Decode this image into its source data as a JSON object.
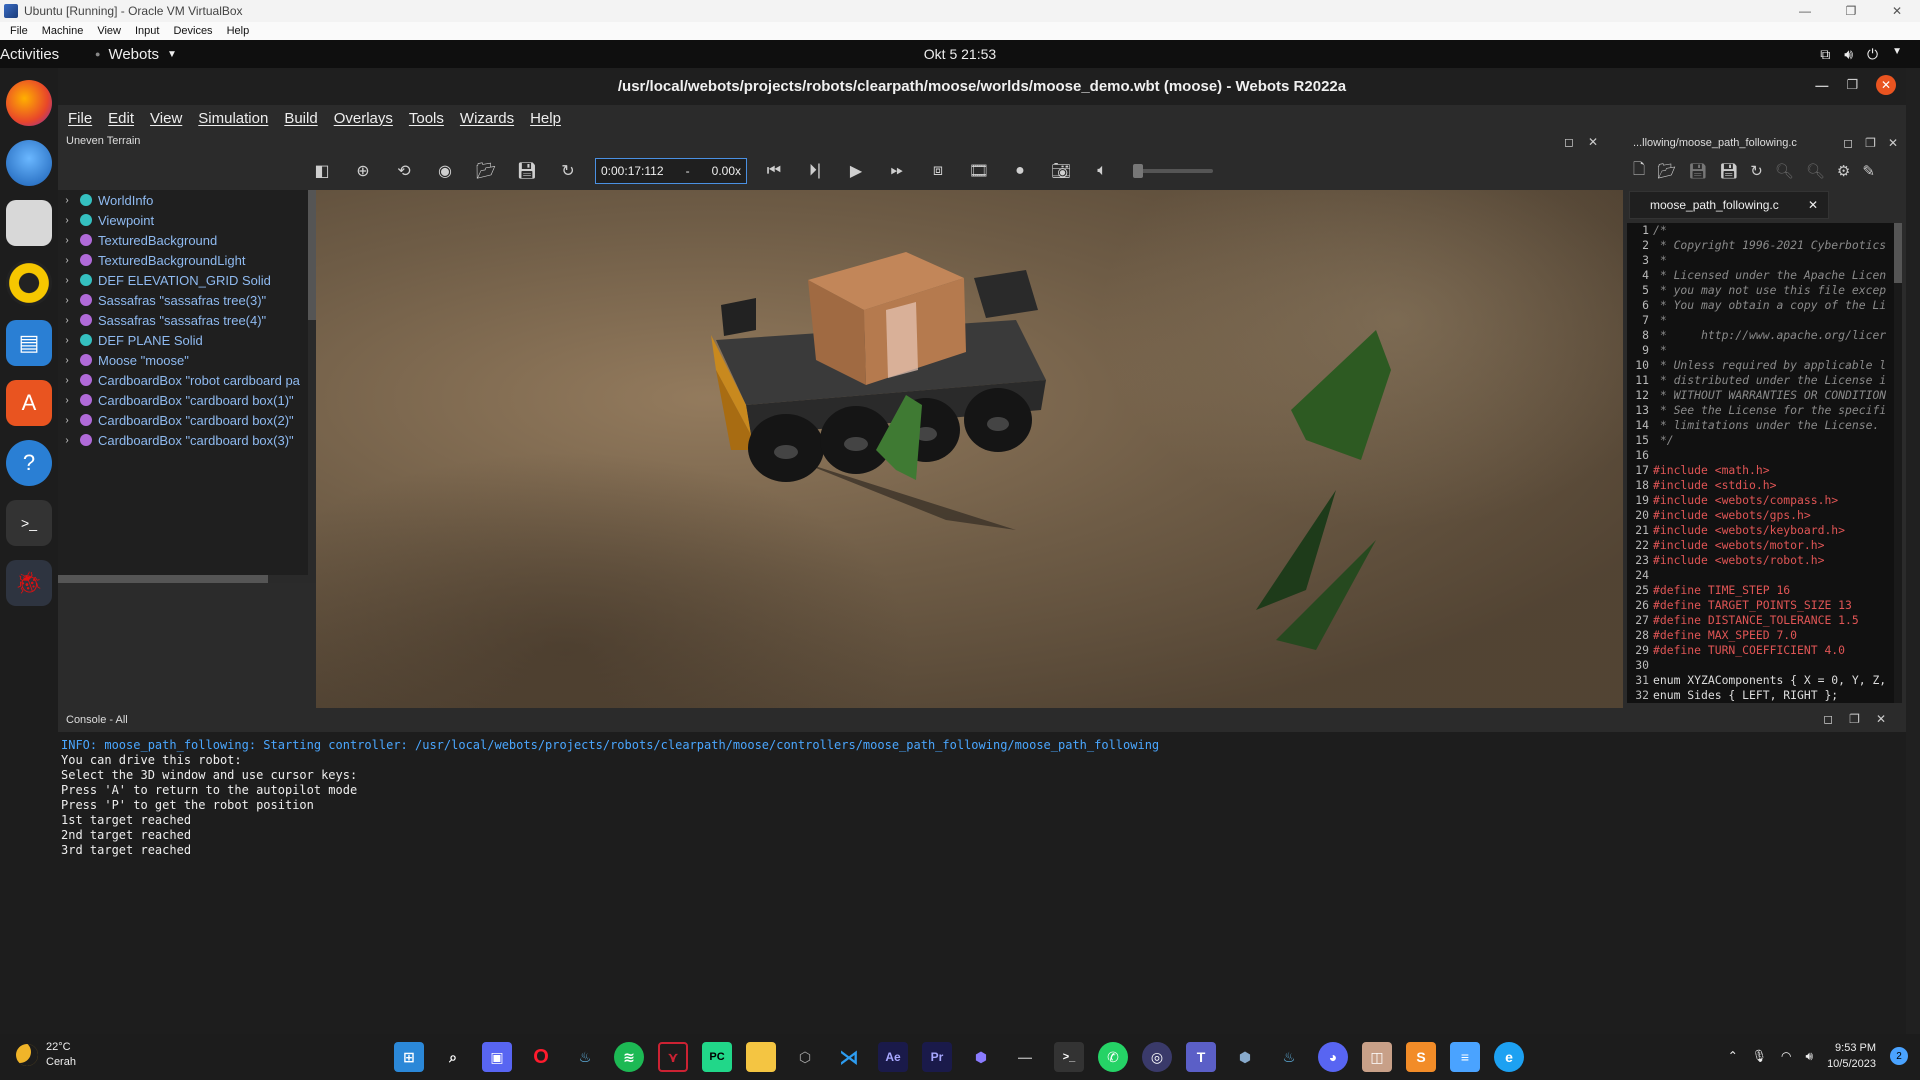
{
  "host": {
    "title": "Ubuntu [Running] - Oracle VM VirtualBox",
    "menu": [
      "File",
      "Machine",
      "View",
      "Input",
      "Devices",
      "Help"
    ]
  },
  "ubuntu": {
    "activities": "Activities",
    "app_name": "Webots",
    "clock": "Okt 5  21:53"
  },
  "webots": {
    "title": "/usr/local/webots/projects/robots/clearpath/moose/worlds/moose_demo.wbt (moose) - Webots R2022a",
    "menu": [
      "File",
      "Edit",
      "View",
      "Simulation",
      "Build",
      "Overlays",
      "Tools",
      "Wizards",
      "Help"
    ],
    "scene_label": "Uneven Terrain",
    "sim_time": "0:00:17:112",
    "sim_dash": "-",
    "sim_speed": "0.00x",
    "tree": [
      {
        "label": "WorldInfo",
        "color": "#35c0c0"
      },
      {
        "label": "Viewpoint",
        "color": "#35c0c0"
      },
      {
        "label": "TexturedBackground",
        "color": "#b06ad8"
      },
      {
        "label": "TexturedBackgroundLight",
        "color": "#b06ad8"
      },
      {
        "label": "DEF ELEVATION_GRID Solid",
        "color": "#35c0c0"
      },
      {
        "label": "Sassafras \"sassafras tree(3)\"",
        "color": "#b06ad8"
      },
      {
        "label": "Sassafras \"sassafras tree(4)\"",
        "color": "#b06ad8"
      },
      {
        "label": "DEF PLANE Solid",
        "color": "#35c0c0"
      },
      {
        "label": "Moose \"moose\"",
        "color": "#b06ad8"
      },
      {
        "label": "CardboardBox \"robot cardboard pa",
        "color": "#b06ad8"
      },
      {
        "label": "CardboardBox \"cardboard box(1)\"",
        "color": "#b06ad8"
      },
      {
        "label": "CardboardBox \"cardboard box(2)\"",
        "color": "#b06ad8"
      },
      {
        "label": "CardboardBox \"cardboard box(3)\"",
        "color": "#b06ad8"
      }
    ],
    "editor": {
      "header": "...llowing/moose_path_following.c",
      "tab": "moose_path_following.c",
      "lines": [
        {
          "n": "1",
          "t": "/*",
          "c": "cmt"
        },
        {
          "n": "2",
          "t": " * Copyright 1996-2021 Cyberbotics",
          "c": "cmt"
        },
        {
          "n": "3",
          "t": " *",
          "c": "cmt"
        },
        {
          "n": "4",
          "t": " * Licensed under the Apache Licen",
          "c": "cmt"
        },
        {
          "n": "5",
          "t": " * you may not use this file excep",
          "c": "cmt"
        },
        {
          "n": "6",
          "t": " * You may obtain a copy of the Li",
          "c": "cmt"
        },
        {
          "n": "7",
          "t": " *",
          "c": "cmt"
        },
        {
          "n": "8",
          "t": " *     http://www.apache.org/licer",
          "c": "cmt"
        },
        {
          "n": "9",
          "t": " *",
          "c": "cmt"
        },
        {
          "n": "10",
          "t": " * Unless required by applicable l",
          "c": "cmt"
        },
        {
          "n": "11",
          "t": " * distributed under the License i",
          "c": "cmt"
        },
        {
          "n": "12",
          "t": " * WITHOUT WARRANTIES OR CONDITION",
          "c": "cmt"
        },
        {
          "n": "13",
          "t": " * See the License for the specifi",
          "c": "cmt"
        },
        {
          "n": "14",
          "t": " * limitations under the License.",
          "c": "cmt"
        },
        {
          "n": "15",
          "t": " */",
          "c": "cmt"
        },
        {
          "n": "16",
          "t": "",
          "c": "txt"
        },
        {
          "n": "17",
          "t": "#include <math.h>",
          "c": "pp"
        },
        {
          "n": "18",
          "t": "#include <stdio.h>",
          "c": "pp"
        },
        {
          "n": "19",
          "t": "#include <webots/compass.h>",
          "c": "pp"
        },
        {
          "n": "20",
          "t": "#include <webots/gps.h>",
          "c": "pp"
        },
        {
          "n": "21",
          "t": "#include <webots/keyboard.h>",
          "c": "pp"
        },
        {
          "n": "22",
          "t": "#include <webots/motor.h>",
          "c": "pp"
        },
        {
          "n": "23",
          "t": "#include <webots/robot.h>",
          "c": "pp"
        },
        {
          "n": "24",
          "t": "",
          "c": "txt"
        },
        {
          "n": "25",
          "t": "#define TIME_STEP 16",
          "c": "pp"
        },
        {
          "n": "26",
          "t": "#define TARGET_POINTS_SIZE 13",
          "c": "pp"
        },
        {
          "n": "27",
          "t": "#define DISTANCE_TOLERANCE 1.5",
          "c": "pp"
        },
        {
          "n": "28",
          "t": "#define MAX_SPEED 7.0",
          "c": "pp"
        },
        {
          "n": "29",
          "t": "#define TURN_COEFFICIENT 4.0",
          "c": "pp"
        },
        {
          "n": "30",
          "t": "",
          "c": "txt"
        },
        {
          "n": "31",
          "t": "enum XYZAComponents { X = 0, Y, Z,",
          "c": "txt"
        },
        {
          "n": "32",
          "t": "enum Sides { LEFT, RIGHT };",
          "c": "txt"
        }
      ]
    },
    "console": {
      "title": "Console - All",
      "lines": [
        {
          "t": "INFO: moose_path_following: Starting controller: /usr/local/webots/projects/robots/clearpath/moose/controllers/moose_path_following/moose_path_following",
          "c": "info"
        },
        {
          "t": "You can drive this robot:",
          "c": ""
        },
        {
          "t": "Select the 3D window and use cursor keys:",
          "c": ""
        },
        {
          "t": "Press 'A' to return to the autopilot mode",
          "c": ""
        },
        {
          "t": "Press 'P' to get the robot position",
          "c": ""
        },
        {
          "t": "1st target reached",
          "c": ""
        },
        {
          "t": "2nd target reached",
          "c": ""
        },
        {
          "t": "3rd target reached",
          "c": ""
        }
      ]
    }
  },
  "taskbar": {
    "temp": "22°C",
    "condition": "Cerah",
    "time": "9:53 PM",
    "date": "10/5/2023",
    "notif_count": "2"
  }
}
